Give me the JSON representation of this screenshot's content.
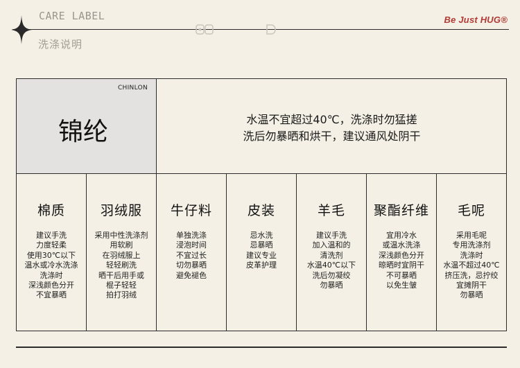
{
  "header": {
    "title_en": "CARE LABEL",
    "title_zh": "洗涤说明",
    "brand": "Be Just HUG®"
  },
  "material": {
    "name_en": "CHINLON",
    "name_zh": "锦纶",
    "instructions": [
      "水温不宜超过40℃，洗涤时勿猛搓",
      "洗后勿暴晒和烘干，建议通风处阴干"
    ]
  },
  "fabrics": [
    {
      "name": "棉质",
      "lines": [
        "建议手洗",
        "力度轻柔",
        "使用30℃以下",
        "温水或冷水洗涤",
        "洗涤时",
        "深浅颜色分开",
        "不宜暴晒"
      ]
    },
    {
      "name": "羽绒服",
      "lines": [
        "采用中性洗涤剂",
        "用软刷",
        "在羽绒服上",
        "轻轻刷洗",
        "晒干后用手或",
        "棍子轻轻",
        "拍打羽绒"
      ]
    },
    {
      "name": "牛仔料",
      "lines": [
        "单独洗涤",
        "浸泡时间",
        "不宜过长",
        "切勿暴晒",
        "避免褪色"
      ]
    },
    {
      "name": "皮装",
      "lines": [
        "忌水洗",
        "忌暴晒",
        "建议专业",
        "皮革护理"
      ]
    },
    {
      "name": "羊毛",
      "lines": [
        "建议手洗",
        "加入温和的",
        "清洗剂",
        "水温40℃以下",
        "洗后勿凝绞",
        "勿暴晒"
      ]
    },
    {
      "name": "聚酯纤维",
      "lines": [
        "宜用冷水",
        "或温水洗涤",
        "深浅颜色分开",
        "晾晒时宜阴干",
        "不可暴晒",
        "以免生皱"
      ]
    },
    {
      "name": "毛呢",
      "lines": [
        "采用毛呢",
        "专用洗涤剂",
        "洗涤时",
        "水温不超过40℃",
        "挤压洗，忌拧绞",
        "宜摊阴干",
        "勿暴晒"
      ]
    }
  ],
  "colors": {
    "background": "#f4f0e5",
    "material_cell": "#e3e2e0",
    "brand": "#b23a34",
    "line": "#2a2a2a"
  }
}
